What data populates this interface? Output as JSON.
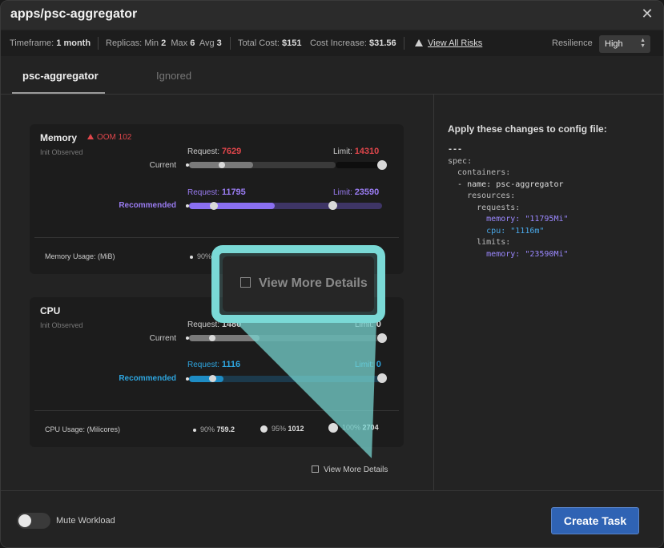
{
  "window": {
    "title": "apps/psc-aggregator",
    "close_icon": "close-icon"
  },
  "info": {
    "timeframe_label": "Timeframe:",
    "timeframe_value": "1 month",
    "replicas_label": "Replicas:",
    "min_label": "Min",
    "min_value": "2",
    "max_label": "Max",
    "max_value": "6",
    "avg_label": "Avg",
    "avg_value": "3",
    "total_cost_label": "Total Cost:",
    "total_cost_value": "$151",
    "cost_increase_label": "Cost Increase:",
    "cost_increase_value": "$31.56",
    "risks_link": "View All Risks",
    "resilience_label": "Resilience",
    "resilience_value": "High"
  },
  "tabs": [
    {
      "label": "psc-aggregator",
      "active": true
    },
    {
      "label": "Ignored",
      "active": false
    }
  ],
  "memory": {
    "title": "Memory",
    "badge": "OOM 102",
    "sub": "Init Observed",
    "current_label": "Current",
    "recommended_label": "Recommended",
    "request_label": "Request:",
    "limit_label": "Limit:",
    "current_request": "7629",
    "current_limit": "14310",
    "rec_request": "11795",
    "rec_limit": "23590",
    "usage_label": "Memory Usage: (MiB)",
    "p90_label": "90%"
  },
  "cpu": {
    "title": "CPU",
    "sub": "Init Observed",
    "current_label": "Current",
    "recommended_label": "Recommended",
    "request_label": "Request:",
    "limit_label": "Limit:",
    "current_request": "1480",
    "current_limit": "0",
    "rec_request": "1116",
    "rec_limit": "0",
    "usage_label": "CPU Usage: (Milicores)",
    "p90_label": "90%",
    "p90_value": "759.2",
    "p95_label": "95%",
    "p95_value": "1012",
    "p100_label": "100%",
    "p100_value": "2704"
  },
  "view_more": "View More Details",
  "config": {
    "title": "Apply these changes to config file:",
    "lines": [
      "---",
      "spec:",
      "  containers:",
      "  - name: psc-aggregator",
      "    resources:",
      "      requests:",
      "        memory: \"11795Mi\"",
      "        cpu: \"1116m\"",
      "      limits:",
      "        memory: \"23590Mi\""
    ]
  },
  "footer": {
    "mute_label": "Mute Workload",
    "mute_on": false,
    "create_label": "Create Task"
  },
  "callout": {
    "text": "View More Details"
  },
  "colors": {
    "accent_teal": "#7ad9d6",
    "purple": "#9a7cf2",
    "blue": "#2ea6e0",
    "red": "#e0464b",
    "primary_button": "#2f63b4"
  }
}
